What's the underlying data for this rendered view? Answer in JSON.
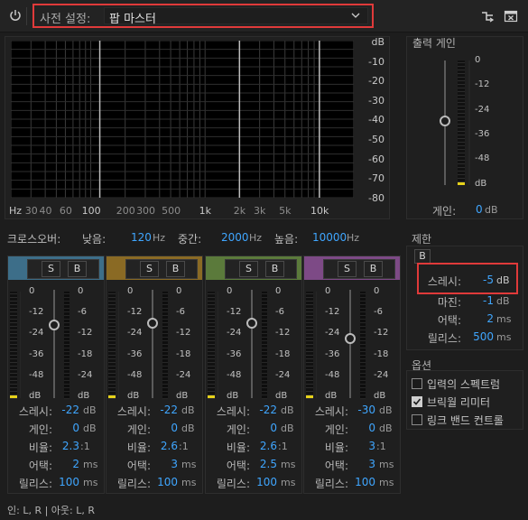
{
  "toolbar": {
    "preset_label": "사전 설정:",
    "preset_value": "팝 마스터",
    "power_icon": "power-icon",
    "routing_icon": "routing-icon",
    "close_icon": "close-icon"
  },
  "graph": {
    "db_labels": [
      "dB",
      "-10",
      "-20",
      "-30",
      "-40",
      "-50",
      "-60",
      "-70",
      "-80"
    ],
    "hz_labels": [
      "Hz",
      "30",
      "40",
      "60",
      "100",
      "200",
      "300",
      "500",
      "1k",
      "2k",
      "3k",
      "5k",
      "10k"
    ]
  },
  "crossover": {
    "label": "크로스오버:",
    "low_label": "낮음:",
    "low_value": "120",
    "low_unit": "Hz",
    "mid_label": "중간:",
    "mid_value": "2000",
    "mid_unit": "Hz",
    "high_label": "높음:",
    "high_value": "10000",
    "high_unit": "Hz"
  },
  "bands": [
    {
      "color": "#3d6e89",
      "solo": "S",
      "bypass": "B",
      "meter_labels": [
        "0",
        "-12",
        "-24",
        "-36",
        "-48",
        "dB"
      ],
      "gain_labels": [
        "0",
        "-6",
        "-12",
        "-18",
        "-24",
        "dB"
      ],
      "threshold_label": "스레시:",
      "threshold": "-22",
      "threshold_unit": "dB",
      "gain_label": "게인:",
      "gain": "0",
      "gain_unit": "dB",
      "ratio_label": "비율:",
      "ratio": "2.3",
      "ratio_unit": ":1",
      "attack_label": "어택:",
      "attack": "2",
      "attack_unit": "ms",
      "release_label": "릴리스:",
      "release": "100",
      "release_unit": "ms"
    },
    {
      "color": "#8a6a24",
      "solo": "S",
      "bypass": "B",
      "meter_labels": [
        "0",
        "-12",
        "-24",
        "-36",
        "-48",
        "dB"
      ],
      "gain_labels": [
        "0",
        "-6",
        "-12",
        "-18",
        "-24",
        "dB"
      ],
      "threshold_label": "스레시:",
      "threshold": "-22",
      "threshold_unit": "dB",
      "gain_label": "게인:",
      "gain": "0",
      "gain_unit": "dB",
      "ratio_label": "비율:",
      "ratio": "2.6",
      "ratio_unit": ":1",
      "attack_label": "어택:",
      "attack": "3",
      "attack_unit": "ms",
      "release_label": "릴리스:",
      "release": "100",
      "release_unit": "ms"
    },
    {
      "color": "#5b7a3b",
      "solo": "S",
      "bypass": "B",
      "meter_labels": [
        "0",
        "-12",
        "-24",
        "-36",
        "-48",
        "dB"
      ],
      "gain_labels": [
        "0",
        "-6",
        "-12",
        "-18",
        "-24",
        "dB"
      ],
      "threshold_label": "스레시:",
      "threshold": "-22",
      "threshold_unit": "dB",
      "gain_label": "게인:",
      "gain": "0",
      "gain_unit": "dB",
      "ratio_label": "비율:",
      "ratio": "2.6",
      "ratio_unit": ":1",
      "attack_label": "어택:",
      "attack": "2.5",
      "attack_unit": "ms",
      "release_label": "릴리스:",
      "release": "100",
      "release_unit": "ms"
    },
    {
      "color": "#7d4a86",
      "solo": "S",
      "bypass": "B",
      "meter_labels": [
        "0",
        "-12",
        "-24",
        "-36",
        "-48",
        "dB"
      ],
      "gain_labels": [
        "0",
        "-6",
        "-12",
        "-18",
        "-24",
        "dB"
      ],
      "threshold_label": "스레시:",
      "threshold": "-30",
      "threshold_unit": "dB",
      "gain_label": "게인:",
      "gain": "0",
      "gain_unit": "dB",
      "ratio_label": "비율:",
      "ratio": "3",
      "ratio_unit": ":1",
      "attack_label": "어택:",
      "attack": "3",
      "attack_unit": "ms",
      "release_label": "릴리스:",
      "release": "100",
      "release_unit": "ms"
    }
  ],
  "output": {
    "title": "출력 게인",
    "meter_labels": [
      "0",
      "-12",
      "-24",
      "-36",
      "-48",
      "dB"
    ],
    "gain_label": "게인:",
    "gain_value": "0",
    "gain_unit": "dB"
  },
  "limiter": {
    "title": "제한",
    "bypass": "B",
    "threshold_label": "스레시:",
    "threshold": "-5",
    "threshold_unit": "dB",
    "margin_label": "마진:",
    "margin": "-1",
    "margin_unit": "dB",
    "attack_label": "어택:",
    "attack": "2",
    "attack_unit": "ms",
    "release_label": "릴리스:",
    "release": "500",
    "release_unit": "ms"
  },
  "options": {
    "title": "옵션",
    "items": [
      {
        "label": "입력의 스펙트럼",
        "checked": false
      },
      {
        "label": "브릭월 리미터",
        "checked": true
      },
      {
        "label": "링크 밴드 컨트롤",
        "checked": false
      }
    ]
  },
  "io": {
    "label": "인: L, R | 아웃: L, R"
  },
  "colors": {
    "accent_blue": "#3fa6ff",
    "highlight_red": "#e03a3a",
    "meter_yellow": "#e6d21a"
  }
}
